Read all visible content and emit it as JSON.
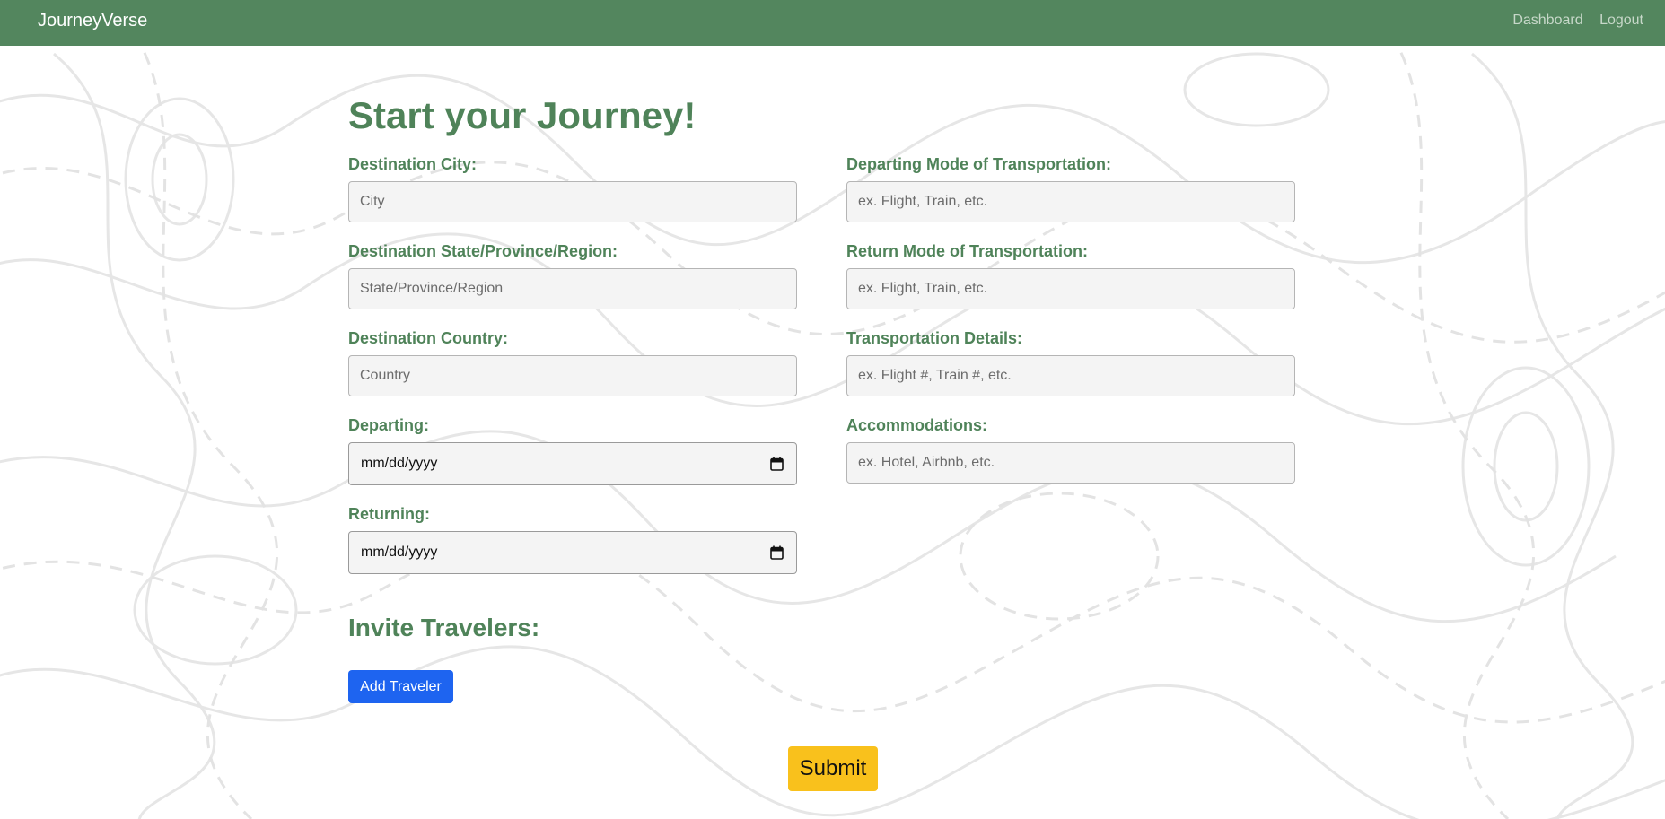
{
  "nav": {
    "brand": "JourneyVerse",
    "links": [
      "Dashboard",
      "Logout"
    ]
  },
  "page": {
    "title": "Start your Journey!"
  },
  "form": {
    "left": [
      {
        "label": "Destination City:",
        "placeholder": "City",
        "type": "text"
      },
      {
        "label": "Destination State/Province/Region:",
        "placeholder": "State/Province/Region",
        "type": "text"
      },
      {
        "label": "Destination Country:",
        "placeholder": "Country",
        "type": "text"
      },
      {
        "label": "Departing:",
        "value": "mm/dd/yyyy",
        "type": "date"
      },
      {
        "label": "Returning:",
        "value": "mm/dd/yyyy",
        "type": "date"
      }
    ],
    "right": [
      {
        "label": "Departing Mode of Transportation:",
        "placeholder": "ex. Flight, Train, etc.",
        "type": "text"
      },
      {
        "label": "Return Mode of Transportation:",
        "placeholder": "ex. Flight, Train, etc.",
        "type": "text"
      },
      {
        "label": "Transportation Details:",
        "placeholder": "ex. Flight #, Train #, etc.",
        "type": "text"
      },
      {
        "label": "Accommodations:",
        "placeholder": "ex. Hotel, Airbnb, etc.",
        "type": "text"
      }
    ]
  },
  "invite": {
    "title": "Invite Travelers:",
    "add_label": "Add Traveler"
  },
  "submit_label": "Submit",
  "colors": {
    "navbar": "#53865e",
    "heading": "#4f8359",
    "add_button": "#1e64f0",
    "submit_button": "#f9c11c"
  }
}
